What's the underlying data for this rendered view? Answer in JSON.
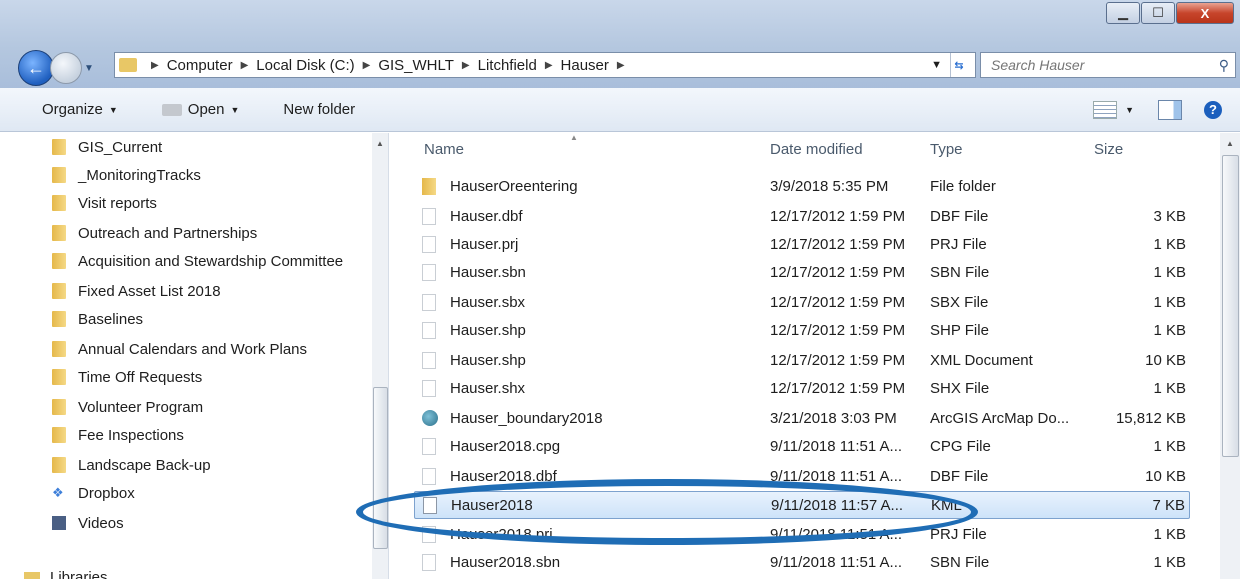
{
  "window": {
    "minimize_icon": "minimize-icon",
    "maximize_icon": "maximize-icon",
    "close_label": "X"
  },
  "address": {
    "crumbs": [
      "Computer",
      "Local Disk (C:)",
      "GIS_WHLT",
      "Litchfield",
      "Hauser"
    ]
  },
  "search": {
    "placeholder": "Search Hauser"
  },
  "toolbar": {
    "organize": "Organize",
    "open": "Open",
    "new_folder": "New folder"
  },
  "nav": {
    "items": [
      {
        "label": "GIS_Current",
        "icon": "folder"
      },
      {
        "label": "_MonitoringTracks",
        "icon": "folder"
      },
      {
        "label": "Visit reports",
        "icon": "folder"
      },
      {
        "label": "Outreach and Partnerships",
        "icon": "folder"
      },
      {
        "label": "Acquisition and Stewardship Committee",
        "icon": "folder"
      },
      {
        "label": "Fixed Asset List 2018",
        "icon": "folder"
      },
      {
        "label": "Baselines",
        "icon": "folder"
      },
      {
        "label": "Annual Calendars and Work Plans",
        "icon": "folder"
      },
      {
        "label": "Time Off Requests",
        "icon": "folder"
      },
      {
        "label": "Volunteer Program",
        "icon": "folder"
      },
      {
        "label": "Fee Inspections",
        "icon": "folder"
      },
      {
        "label": "Landscape Back-up",
        "icon": "folder"
      },
      {
        "label": "Dropbox",
        "icon": "dropbox"
      },
      {
        "label": "Videos",
        "icon": "videos"
      },
      {
        "label": "Libraries",
        "icon": "libraries"
      }
    ]
  },
  "columns": {
    "name": "Name",
    "date": "Date modified",
    "type": "Type",
    "size": "Size"
  },
  "files": [
    {
      "name": "HauserOreentering",
      "date": "3/9/2018 5:35 PM",
      "type": "File folder",
      "size": "",
      "icon": "folder"
    },
    {
      "name": "Hauser.dbf",
      "date": "12/17/2012 1:59 PM",
      "type": "DBF File",
      "size": "3 KB",
      "icon": "file"
    },
    {
      "name": "Hauser.prj",
      "date": "12/17/2012 1:59 PM",
      "type": "PRJ File",
      "size": "1 KB",
      "icon": "file"
    },
    {
      "name": "Hauser.sbn",
      "date": "12/17/2012 1:59 PM",
      "type": "SBN File",
      "size": "1 KB",
      "icon": "file"
    },
    {
      "name": "Hauser.sbx",
      "date": "12/17/2012 1:59 PM",
      "type": "SBX File",
      "size": "1 KB",
      "icon": "file"
    },
    {
      "name": "Hauser.shp",
      "date": "12/17/2012 1:59 PM",
      "type": "SHP File",
      "size": "1 KB",
      "icon": "file"
    },
    {
      "name": "Hauser.shp",
      "date": "12/17/2012 1:59 PM",
      "type": "XML Document",
      "size": "10 KB",
      "icon": "file"
    },
    {
      "name": "Hauser.shx",
      "date": "12/17/2012 1:59 PM",
      "type": "SHX File",
      "size": "1 KB",
      "icon": "file"
    },
    {
      "name": "Hauser_boundary2018",
      "date": "3/21/2018 3:03 PM",
      "type": "ArcGIS ArcMap Do...",
      "size": "15,812 KB",
      "icon": "globe"
    },
    {
      "name": "Hauser2018.cpg",
      "date": "9/11/2018 11:51 A...",
      "type": "CPG File",
      "size": "1 KB",
      "icon": "file"
    },
    {
      "name": "Hauser2018.dbf",
      "date": "9/11/2018 11:51 A...",
      "type": "DBF File",
      "size": "10 KB",
      "icon": "file"
    },
    {
      "name": "Hauser2018",
      "date": "9/11/2018 11:57 A...",
      "type": "KML",
      "size": "7 KB",
      "icon": "kml",
      "selected": true
    },
    {
      "name": "Hauser2018.prj",
      "date": "9/11/2018 11:51 A...",
      "type": "PRJ File",
      "size": "1 KB",
      "icon": "file"
    },
    {
      "name": "Hauser2018.sbn",
      "date": "9/11/2018 11:51 A...",
      "type": "SBN File",
      "size": "1 KB",
      "icon": "file"
    }
  ],
  "annotation": {
    "highlight_color": "#1f6db5"
  }
}
